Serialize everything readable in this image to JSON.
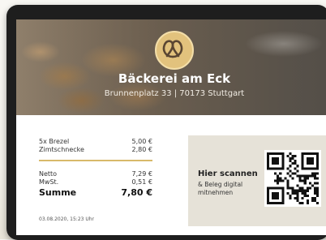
{
  "store": {
    "name": "Bäckerei am Eck",
    "address": "Brunnenplatz 33 | 70173 Stuttgart",
    "logo_icon": "pretzel-icon"
  },
  "items": [
    {
      "label": "5x Brezel",
      "price": "5,00 €"
    },
    {
      "label": "Zimtschnecke",
      "price": "2,80 €"
    }
  ],
  "totals": {
    "net_label": "Netto",
    "net_value": "7,29 €",
    "tax_label": "MwSt.",
    "tax_value": "0,51 €",
    "sum_label": "Summe",
    "sum_value": "7,80 €"
  },
  "timestamp": "03.08.2020, 15:23 Uhr",
  "scan": {
    "title": "Hier scannen",
    "subtitle_line1": "& Beleg digital",
    "subtitle_line2": "mitnehmen",
    "qr_icon": "qr-code-icon"
  },
  "colors": {
    "accent": "#d8b96a",
    "logo_bg": "#e2c27d",
    "panel_bg": "#e6e2d8"
  }
}
